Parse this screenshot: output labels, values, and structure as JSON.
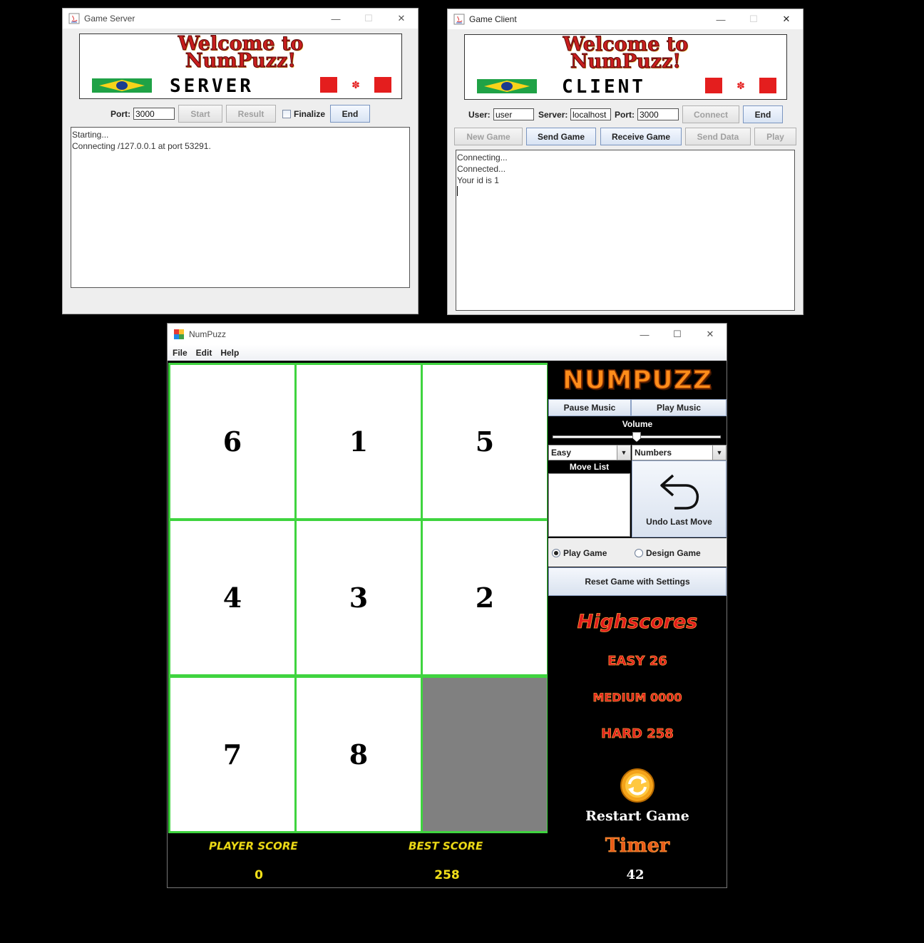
{
  "server_window": {
    "title": "Game Server",
    "banner_line1": "Welcome to",
    "banner_line2": "NumPuzz!",
    "banner_role": "SERVER",
    "port_label": "Port:",
    "port_value": "3000",
    "start_label": "Start",
    "result_label": "Result",
    "finalize_label": "Finalize",
    "end_label": "End",
    "log_lines": [
      "Starting...",
      "Connecting /127.0.0.1 at port 53291."
    ]
  },
  "client_window": {
    "title": "Game Client",
    "banner_line1": "Welcome to",
    "banner_line2": "NumPuzz!",
    "banner_role": "CLIENT",
    "user_label": "User:",
    "user_value": "user",
    "server_label": "Server:",
    "server_value": "localhost",
    "port_label": "Port:",
    "port_value": "3000",
    "connect_label": "Connect",
    "end_label": "End",
    "new_game_label": "New Game",
    "send_game_label": "Send Game",
    "receive_game_label": "Receive Game",
    "send_data_label": "Send Data",
    "play_label": "Play",
    "log_lines": [
      "Connecting...",
      "Connected...",
      "Your id is 1"
    ]
  },
  "numpuzz": {
    "title": "NumPuzz",
    "menu": [
      "File",
      "Edit",
      "Help"
    ],
    "tiles": [
      "6",
      "1",
      "5",
      "4",
      "3",
      "2",
      "7",
      "8",
      ""
    ],
    "logo": "NUMPUZZ",
    "pause_music_label": "Pause Music",
    "play_music_label": "Play Music",
    "volume_label": "Volume",
    "volume_level": 0.5,
    "difficulty_selected": "Easy",
    "mode_selected": "Numbers",
    "move_list_label": "Move List",
    "undo_label": "Undo Last Move",
    "play_game_label": "Play Game",
    "design_game_label": "Design Game",
    "reset_label": "Reset Game with Settings",
    "highscores_label": "Highscores",
    "easy_label": "EASY",
    "easy_score": "26",
    "medium_label": "MEDIUM",
    "medium_score": "0000",
    "hard_label": "HARD",
    "hard_score": "258",
    "restart_label": "Restart Game",
    "timer_label": "Timer",
    "timer_value": "42",
    "player_score_label": "PLAYER SCORE",
    "player_score_value": "0",
    "best_score_label": "BEST SCORE",
    "best_score_value": "258"
  },
  "colors": {
    "grid_green": "#3fd43f",
    "empty_tile": "#808080",
    "score_yellow": "#f2e019",
    "fire_red": "#e01b1b"
  }
}
